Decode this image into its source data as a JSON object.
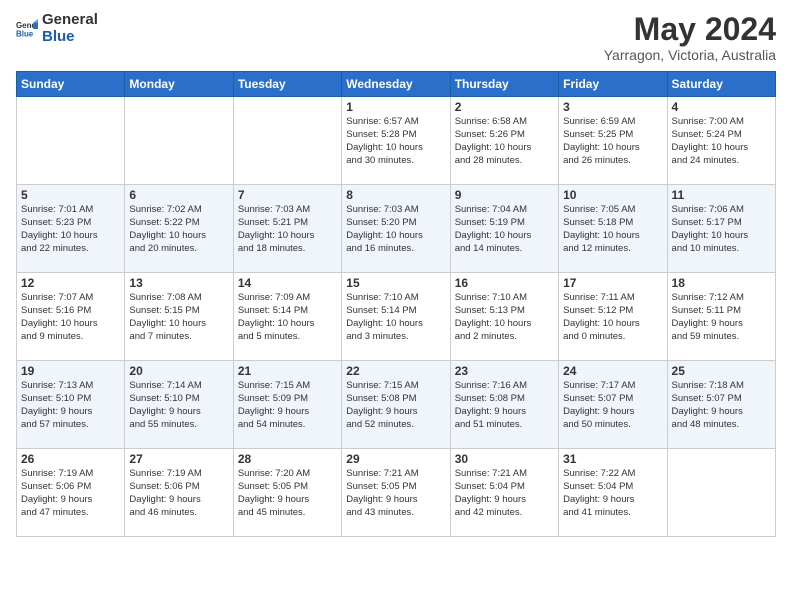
{
  "header": {
    "logo_general": "General",
    "logo_blue": "Blue",
    "month_title": "May 2024",
    "location": "Yarragon, Victoria, Australia"
  },
  "weekdays": [
    "Sunday",
    "Monday",
    "Tuesday",
    "Wednesday",
    "Thursday",
    "Friday",
    "Saturday"
  ],
  "weeks": [
    [
      {
        "day": "",
        "info": ""
      },
      {
        "day": "",
        "info": ""
      },
      {
        "day": "",
        "info": ""
      },
      {
        "day": "1",
        "info": "Sunrise: 6:57 AM\nSunset: 5:28 PM\nDaylight: 10 hours\nand 30 minutes."
      },
      {
        "day": "2",
        "info": "Sunrise: 6:58 AM\nSunset: 5:26 PM\nDaylight: 10 hours\nand 28 minutes."
      },
      {
        "day": "3",
        "info": "Sunrise: 6:59 AM\nSunset: 5:25 PM\nDaylight: 10 hours\nand 26 minutes."
      },
      {
        "day": "4",
        "info": "Sunrise: 7:00 AM\nSunset: 5:24 PM\nDaylight: 10 hours\nand 24 minutes."
      }
    ],
    [
      {
        "day": "5",
        "info": "Sunrise: 7:01 AM\nSunset: 5:23 PM\nDaylight: 10 hours\nand 22 minutes."
      },
      {
        "day": "6",
        "info": "Sunrise: 7:02 AM\nSunset: 5:22 PM\nDaylight: 10 hours\nand 20 minutes."
      },
      {
        "day": "7",
        "info": "Sunrise: 7:03 AM\nSunset: 5:21 PM\nDaylight: 10 hours\nand 18 minutes."
      },
      {
        "day": "8",
        "info": "Sunrise: 7:03 AM\nSunset: 5:20 PM\nDaylight: 10 hours\nand 16 minutes."
      },
      {
        "day": "9",
        "info": "Sunrise: 7:04 AM\nSunset: 5:19 PM\nDaylight: 10 hours\nand 14 minutes."
      },
      {
        "day": "10",
        "info": "Sunrise: 7:05 AM\nSunset: 5:18 PM\nDaylight: 10 hours\nand 12 minutes."
      },
      {
        "day": "11",
        "info": "Sunrise: 7:06 AM\nSunset: 5:17 PM\nDaylight: 10 hours\nand 10 minutes."
      }
    ],
    [
      {
        "day": "12",
        "info": "Sunrise: 7:07 AM\nSunset: 5:16 PM\nDaylight: 10 hours\nand 9 minutes."
      },
      {
        "day": "13",
        "info": "Sunrise: 7:08 AM\nSunset: 5:15 PM\nDaylight: 10 hours\nand 7 minutes."
      },
      {
        "day": "14",
        "info": "Sunrise: 7:09 AM\nSunset: 5:14 PM\nDaylight: 10 hours\nand 5 minutes."
      },
      {
        "day": "15",
        "info": "Sunrise: 7:10 AM\nSunset: 5:14 PM\nDaylight: 10 hours\nand 3 minutes."
      },
      {
        "day": "16",
        "info": "Sunrise: 7:10 AM\nSunset: 5:13 PM\nDaylight: 10 hours\nand 2 minutes."
      },
      {
        "day": "17",
        "info": "Sunrise: 7:11 AM\nSunset: 5:12 PM\nDaylight: 10 hours\nand 0 minutes."
      },
      {
        "day": "18",
        "info": "Sunrise: 7:12 AM\nSunset: 5:11 PM\nDaylight: 9 hours\nand 59 minutes."
      }
    ],
    [
      {
        "day": "19",
        "info": "Sunrise: 7:13 AM\nSunset: 5:10 PM\nDaylight: 9 hours\nand 57 minutes."
      },
      {
        "day": "20",
        "info": "Sunrise: 7:14 AM\nSunset: 5:10 PM\nDaylight: 9 hours\nand 55 minutes."
      },
      {
        "day": "21",
        "info": "Sunrise: 7:15 AM\nSunset: 5:09 PM\nDaylight: 9 hours\nand 54 minutes."
      },
      {
        "day": "22",
        "info": "Sunrise: 7:15 AM\nSunset: 5:08 PM\nDaylight: 9 hours\nand 52 minutes."
      },
      {
        "day": "23",
        "info": "Sunrise: 7:16 AM\nSunset: 5:08 PM\nDaylight: 9 hours\nand 51 minutes."
      },
      {
        "day": "24",
        "info": "Sunrise: 7:17 AM\nSunset: 5:07 PM\nDaylight: 9 hours\nand 50 minutes."
      },
      {
        "day": "25",
        "info": "Sunrise: 7:18 AM\nSunset: 5:07 PM\nDaylight: 9 hours\nand 48 minutes."
      }
    ],
    [
      {
        "day": "26",
        "info": "Sunrise: 7:19 AM\nSunset: 5:06 PM\nDaylight: 9 hours\nand 47 minutes."
      },
      {
        "day": "27",
        "info": "Sunrise: 7:19 AM\nSunset: 5:06 PM\nDaylight: 9 hours\nand 46 minutes."
      },
      {
        "day": "28",
        "info": "Sunrise: 7:20 AM\nSunset: 5:05 PM\nDaylight: 9 hours\nand 45 minutes."
      },
      {
        "day": "29",
        "info": "Sunrise: 7:21 AM\nSunset: 5:05 PM\nDaylight: 9 hours\nand 43 minutes."
      },
      {
        "day": "30",
        "info": "Sunrise: 7:21 AM\nSunset: 5:04 PM\nDaylight: 9 hours\nand 42 minutes."
      },
      {
        "day": "31",
        "info": "Sunrise: 7:22 AM\nSunset: 5:04 PM\nDaylight: 9 hours\nand 41 minutes."
      },
      {
        "day": "",
        "info": ""
      }
    ]
  ]
}
